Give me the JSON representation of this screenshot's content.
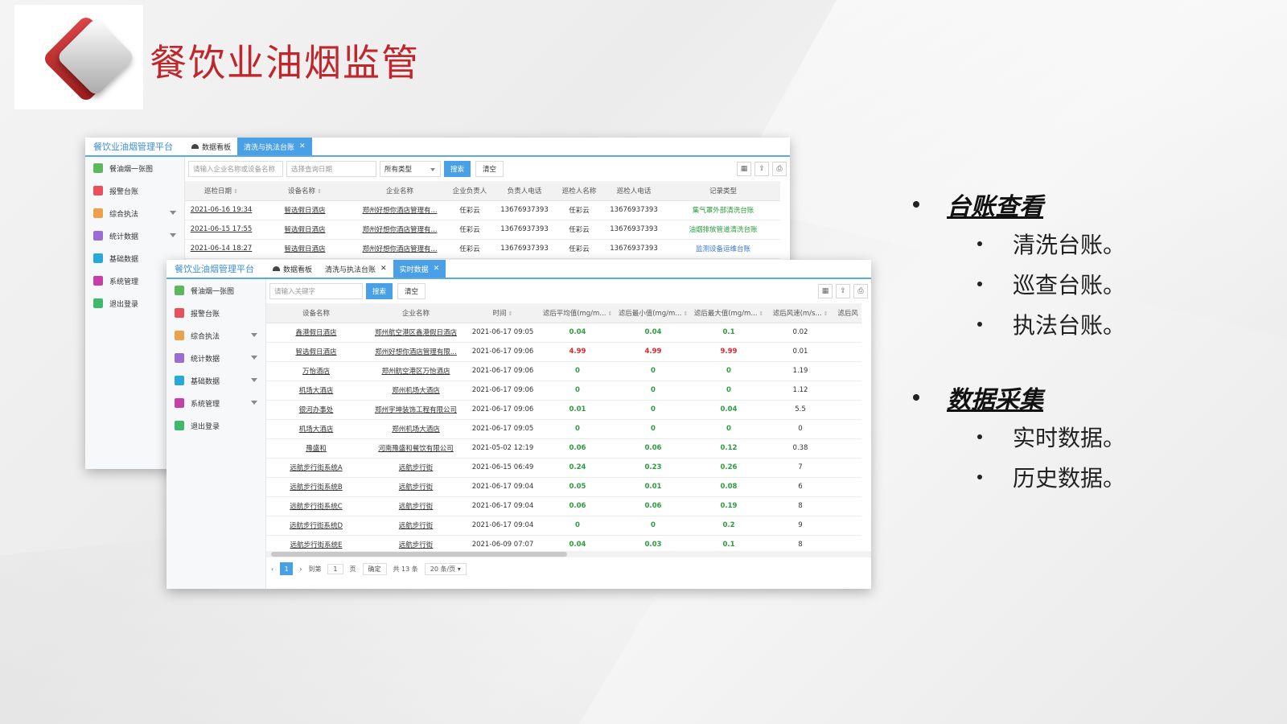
{
  "slide": {
    "title": "餐饮业油烟监管",
    "logo": "diamond-logo"
  },
  "bullets": [
    {
      "heading": "台账查看",
      "items": [
        "清洗台账。",
        "巡查台账。",
        "执法台账。"
      ]
    },
    {
      "heading": "数据采集",
      "items": [
        "实时数据。",
        "历史数据。"
      ]
    }
  ],
  "win1": {
    "brand": "餐饮业油烟管理平台",
    "tabs": [
      {
        "label": "数据看板",
        "icon": "dashboard-icon"
      },
      {
        "label": "清洗与执法台账",
        "active": true,
        "close": "✕"
      }
    ],
    "sidebar": [
      {
        "label": "餐油烟一张图",
        "color": "#5cb85c"
      },
      {
        "label": "报警台账",
        "color": "#e8505b"
      },
      {
        "label": "综合执法",
        "color": "#f0a04b",
        "chevron": true
      },
      {
        "label": "统计数据",
        "color": "#9b6cd6",
        "chevron": true
      },
      {
        "label": "基础数据",
        "color": "#29a9d9"
      },
      {
        "label": "系统管理",
        "color": "#c43fa8"
      },
      {
        "label": "退出登录",
        "color": "#3fb96a"
      }
    ],
    "toolbar": {
      "search_placeholder": "请输入企业名称或设备名称",
      "date_placeholder": "选择查询日期",
      "type_select": "所有类型",
      "search_btn": "搜索",
      "clear_btn": "清空"
    },
    "columns": [
      "巡检日期",
      "设备名称",
      "企业名称",
      "企业负责人",
      "负责人电话",
      "巡检人名称",
      "巡检人电话",
      "记录类型"
    ],
    "rows": [
      [
        "2021-06-16 19:34",
        "智选假日酒店",
        "郑州好想你酒店管理有...",
        "任彩云",
        "13676937393",
        "任彩云",
        "13676937393",
        "集气罩外部清洗台账"
      ],
      [
        "2021-06-15 17:55",
        "智选假日酒店",
        "郑州好想你酒店管理有...",
        "任彩云",
        "13676937393",
        "任彩云",
        "13676937393",
        "油烟排放管道清洗台账"
      ],
      [
        "2021-06-14 18:27",
        "智选假日酒店",
        "郑州好想你酒店管理有...",
        "任彩云",
        "13676937393",
        "任彩云",
        "13676937393",
        "监测设备运维台账"
      ]
    ]
  },
  "win2": {
    "brand": "餐饮业油烟管理平台",
    "tabs": [
      {
        "label": "数据看板",
        "icon": "dashboard-icon"
      },
      {
        "label": "清洗与执法台账",
        "close": "✕"
      },
      {
        "label": "实时数据",
        "active": true,
        "close": "✕"
      }
    ],
    "sidebar": [
      {
        "label": "餐油烟一张图",
        "color": "#5cb85c"
      },
      {
        "label": "报警台账",
        "color": "#e8505b"
      },
      {
        "label": "综合执法",
        "color": "#f0a04b",
        "chevron": true
      },
      {
        "label": "统计数据",
        "color": "#9b6cd6",
        "chevron": true
      },
      {
        "label": "基础数据",
        "color": "#29a9d9",
        "chevron": true
      },
      {
        "label": "系统管理",
        "color": "#c43fa8",
        "chevron": true
      },
      {
        "label": "退出登录",
        "color": "#3fb96a"
      }
    ],
    "toolbar": {
      "keyword_placeholder": "请输入关键字",
      "search_btn": "搜索",
      "clear_btn": "清空"
    },
    "columns": [
      "设备名称",
      "企业名称",
      "时间",
      "滤后平均值(mg/m...",
      "滤后最小值(mg/m...",
      "滤后最大值(mg/m...",
      "滤后风速(m/s...",
      "滤后风"
    ],
    "rows": [
      [
        "鑫港假日酒店",
        "郑州航空港区鑫港假日酒店",
        "2021-06-17 09:05",
        "0.04",
        "0.04",
        "0.1",
        "0.02"
      ],
      [
        "智选假日酒店",
        "郑州好想你酒店管理有限...",
        "2021-06-17 09:06",
        "4.99",
        "4.99",
        "9.99",
        "0.01"
      ],
      [
        "万怡酒店",
        "郑州航空港区万怡酒店",
        "2021-06-17 09:06",
        "0",
        "0",
        "0",
        "1.19"
      ],
      [
        "机场大酒店",
        "郑州机场大酒店",
        "2021-06-17 09:06",
        "0",
        "0",
        "0",
        "1.12"
      ],
      [
        "银河办事处",
        "郑州宇坤装饰工程有限公司",
        "2021-06-17 09:06",
        "0.01",
        "0",
        "0.04",
        "5.5"
      ],
      [
        "机场大酒店",
        "郑州机场大酒店",
        "2021-06-17 09:05",
        "0",
        "0",
        "0",
        "0"
      ],
      [
        "豫盛和",
        "河南豫盛和餐饮有限公司",
        "2021-05-02 12:19",
        "0.06",
        "0.06",
        "0.12",
        "0.38"
      ],
      [
        "远航步行街系统A",
        "远航步行街",
        "2021-06-15 06:49",
        "0.24",
        "0.23",
        "0.26",
        "7"
      ],
      [
        "远航步行街系统B",
        "远航步行街",
        "2021-06-17 09:04",
        "0.05",
        "0.01",
        "0.08",
        "6"
      ],
      [
        "远航步行街系统C",
        "远航步行街",
        "2021-06-17 09:04",
        "0.06",
        "0.06",
        "0.19",
        "8"
      ],
      [
        "远航步行街系统D",
        "远航步行街",
        "2021-06-17 09:04",
        "0",
        "0",
        "0.2",
        "9"
      ],
      [
        "远航步行街系统E",
        "远航步行街",
        "2021-06-09 07:07",
        "0.04",
        "0.03",
        "0.1",
        "8"
      ]
    ],
    "red_rows": [
      1
    ],
    "pager": {
      "current": "1",
      "goto": "到第",
      "page_input": "1",
      "page_unit": "页",
      "confirm": "确定",
      "total": "共 13 条",
      "per_page": "20 条/页"
    }
  },
  "colors": {
    "accent_blue": "#4aa0e6",
    "title_red": "#c0272d",
    "value_green": "#2a9d3c",
    "value_red": "#d9262c"
  }
}
